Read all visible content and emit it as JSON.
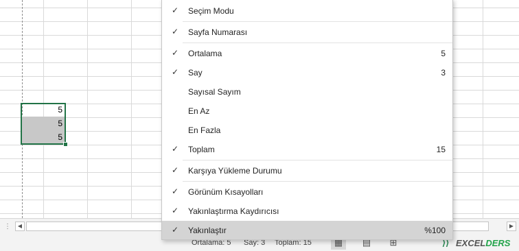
{
  "sheet": {
    "cells": [
      "5",
      "5",
      "5"
    ]
  },
  "menu": {
    "items": [
      {
        "label": "Seçim Modu",
        "checked": true,
        "value": ""
      },
      {
        "label": "Sayfa Numarası",
        "checked": true,
        "value": ""
      },
      {
        "label": "Ortalama",
        "checked": true,
        "value": "5"
      },
      {
        "label": "Say",
        "checked": true,
        "value": "3"
      },
      {
        "label": "Sayısal Sayım",
        "checked": false,
        "value": ""
      },
      {
        "label": "En Az",
        "checked": false,
        "value": ""
      },
      {
        "label": "En Fazla",
        "checked": false,
        "value": ""
      },
      {
        "label": "Toplam",
        "checked": true,
        "value": "15"
      },
      {
        "label": "Karşıya Yükleme Durumu",
        "checked": true,
        "value": ""
      },
      {
        "label": "Görünüm Kısayolları",
        "checked": true,
        "value": ""
      },
      {
        "label": "Yakınlaştırma Kaydırıcısı",
        "checked": true,
        "value": ""
      },
      {
        "label": "Yakınlaştır",
        "checked": true,
        "value": "%100",
        "highlighted": true
      }
    ],
    "check_glyph": "✓"
  },
  "scrollbar": {
    "sheet_dots": "⋮",
    "left_arrow": "◀",
    "right_arrow": "▶"
  },
  "status_bar": {
    "average": "Ortalama: 5",
    "count": "Say: 3",
    "sum": "Toplam: 15",
    "views": [
      {
        "name": "normal-view-icon",
        "glyph": "▦",
        "active": true
      },
      {
        "name": "page-layout-icon",
        "glyph": "▤",
        "active": false
      },
      {
        "name": "page-break-preview-icon",
        "glyph": "⊞",
        "active": false
      }
    ]
  },
  "watermark": {
    "arrow": "⟩⟩",
    "part1": "EXCEL",
    "part2": "DERS"
  },
  "colors": {
    "selection_border": "#217346",
    "selected_fill": "#c8c8c8",
    "menu_highlight": "#d4d4d4"
  }
}
